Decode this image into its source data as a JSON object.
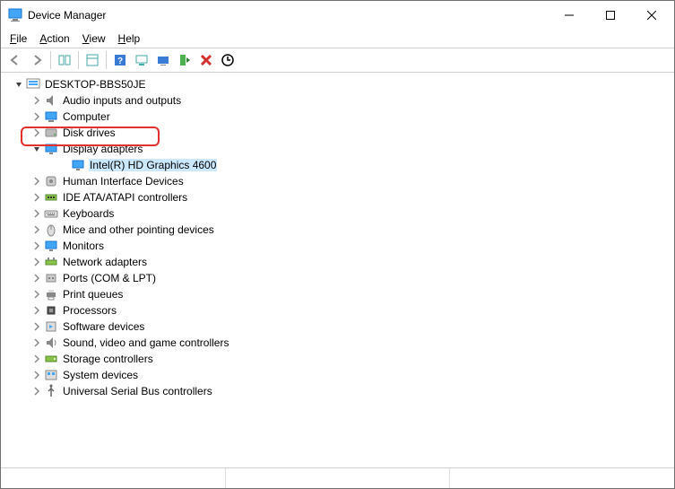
{
  "window": {
    "title": "Device Manager"
  },
  "menubar": {
    "file": "File",
    "action": "Action",
    "view": "View",
    "help": "Help"
  },
  "tree": {
    "root": "DESKTOP-BBS50JE",
    "items": [
      {
        "label": "Audio inputs and outputs",
        "icon": "audio"
      },
      {
        "label": "Computer",
        "icon": "computer"
      },
      {
        "label": "Disk drives",
        "icon": "disk"
      },
      {
        "label": "Display adapters",
        "icon": "display",
        "expanded": true,
        "children": [
          {
            "label": "Intel(R) HD Graphics 4600",
            "icon": "display",
            "selected": true
          }
        ]
      },
      {
        "label": "Human Interface Devices",
        "icon": "hid"
      },
      {
        "label": "IDE ATA/ATAPI controllers",
        "icon": "ide"
      },
      {
        "label": "Keyboards",
        "icon": "keyboard"
      },
      {
        "label": "Mice and other pointing devices",
        "icon": "mouse"
      },
      {
        "label": "Monitors",
        "icon": "monitor"
      },
      {
        "label": "Network adapters",
        "icon": "network"
      },
      {
        "label": "Ports (COM & LPT)",
        "icon": "ports"
      },
      {
        "label": "Print queues",
        "icon": "print"
      },
      {
        "label": "Processors",
        "icon": "cpu"
      },
      {
        "label": "Software devices",
        "icon": "software"
      },
      {
        "label": "Sound, video and game controllers",
        "icon": "sound"
      },
      {
        "label": "Storage controllers",
        "icon": "storage"
      },
      {
        "label": "System devices",
        "icon": "system"
      },
      {
        "label": "Universal Serial Bus controllers",
        "icon": "usb"
      }
    ]
  }
}
